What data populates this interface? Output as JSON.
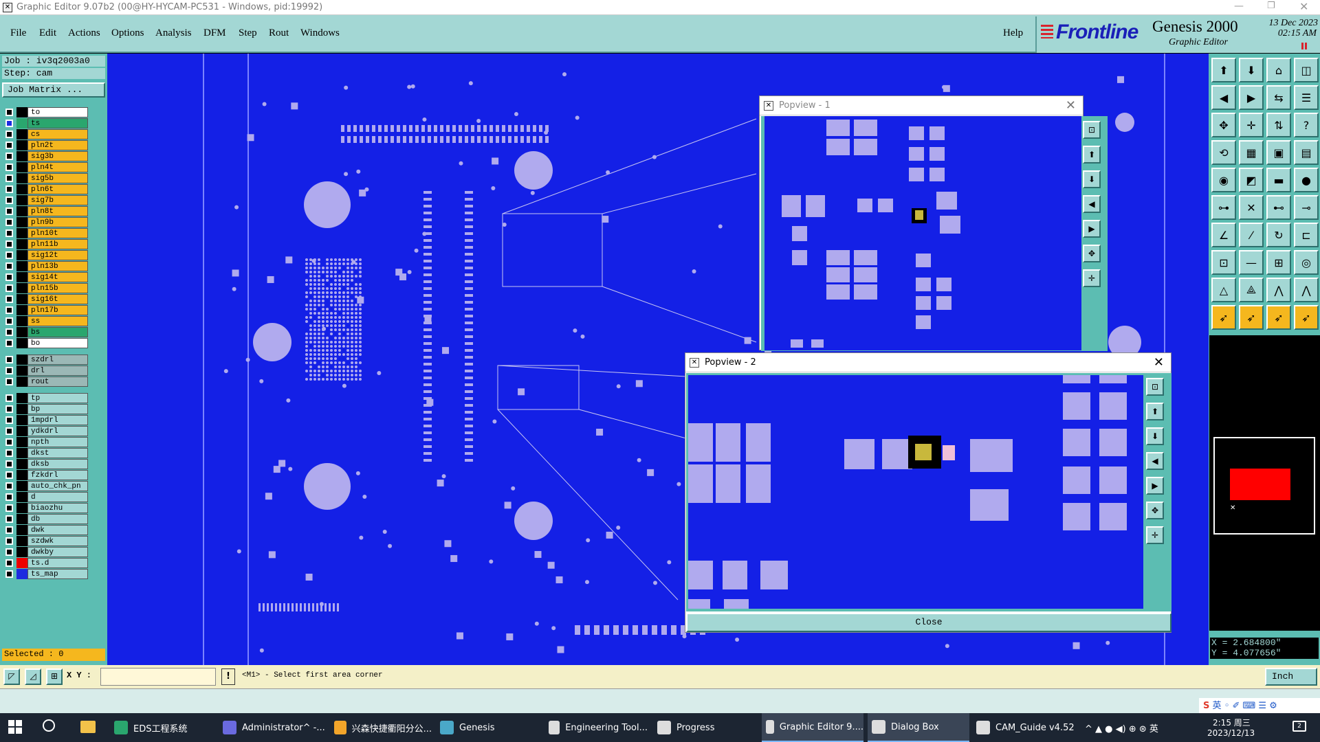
{
  "window": {
    "title": "Graphic Editor 9.07b2 (00@HY-HYCAM-PC531 - Windows, pid:19992)"
  },
  "menus": [
    "File",
    "Edit",
    "Actions",
    "Options",
    "Analysis",
    "DFM",
    "Step",
    "Rout",
    "Windows"
  ],
  "help": "Help",
  "brand": {
    "logo": "Frontline",
    "product": "Genesis 2000",
    "subtitle": "Graphic Editor",
    "date": "13 Dec 2023",
    "time": "02:15 AM"
  },
  "job": {
    "job_label": "Job  :  iv3q2003a0",
    "step_label": "Step:  cam",
    "matrix_button": "Job Matrix ..."
  },
  "layers": [
    {
      "name": "to",
      "color": "#ffffff"
    },
    {
      "name": "ts",
      "color": "#2aa66e"
    },
    {
      "name": "cs",
      "color": "#f5b71e"
    },
    {
      "name": "pln2t",
      "color": "#f5b71e"
    },
    {
      "name": "sig3b",
      "color": "#f5b71e"
    },
    {
      "name": "pln4t",
      "color": "#f5b71e"
    },
    {
      "name": "sig5b",
      "color": "#f5b71e"
    },
    {
      "name": "pln6t",
      "color": "#f5b71e"
    },
    {
      "name": "sig7b",
      "color": "#f5b71e"
    },
    {
      "name": "pln8t",
      "color": "#f5b71e"
    },
    {
      "name": "pln9b",
      "color": "#f5b71e"
    },
    {
      "name": "pln10t",
      "color": "#f5b71e"
    },
    {
      "name": "pln11b",
      "color": "#f5b71e"
    },
    {
      "name": "sig12t",
      "color": "#f5b71e"
    },
    {
      "name": "pln13b",
      "color": "#f5b71e"
    },
    {
      "name": "sig14t",
      "color": "#f5b71e"
    },
    {
      "name": "pln15b",
      "color": "#f5b71e"
    },
    {
      "name": "sig16t",
      "color": "#f5b71e"
    },
    {
      "name": "pln17b",
      "color": "#f5b71e"
    },
    {
      "name": "ss",
      "color": "#f5b71e"
    },
    {
      "name": "bs",
      "color": "#2aa66e"
    },
    {
      "name": "bo",
      "color": "#ffffff"
    },
    {
      "name": "szdrl",
      "color": "#9bb8b6"
    },
    {
      "name": "drl",
      "color": "#9bb8b6"
    },
    {
      "name": "rout",
      "color": "#9bb8b6"
    },
    {
      "name": "tp",
      "color": "#a3d7d4"
    },
    {
      "name": "bp",
      "color": "#a3d7d4"
    },
    {
      "name": "1mpdrl",
      "color": "#a3d7d4"
    },
    {
      "name": "ydkdrl",
      "color": "#a3d7d4"
    },
    {
      "name": "npth",
      "color": "#a3d7d4"
    },
    {
      "name": "dkst",
      "color": "#a3d7d4"
    },
    {
      "name": "dksb",
      "color": "#a3d7d4"
    },
    {
      "name": "fzkdrl",
      "color": "#a3d7d4"
    },
    {
      "name": "auto_chk_pn",
      "color": "#a3d7d4"
    },
    {
      "name": "d",
      "color": "#a3d7d4"
    },
    {
      "name": "biaozhu",
      "color": "#a3d7d4"
    },
    {
      "name": "db",
      "color": "#a3d7d4"
    },
    {
      "name": "dwk",
      "color": "#a3d7d4"
    },
    {
      "name": "szdwk",
      "color": "#a3d7d4"
    },
    {
      "name": "dwkby",
      "color": "#a3d7d4"
    },
    {
      "name": "ts.d",
      "color": "#a3d7d4"
    },
    {
      "name": "ts_map",
      "color": "#a3d7d4"
    }
  ],
  "selected": "Selected : 0",
  "popview1": {
    "title": "Popview - 1"
  },
  "popview2": {
    "title": "Popview - 2",
    "close_button": "Close"
  },
  "coords": {
    "x": "X = 2.684800\"",
    "y": "Y = 4.077656\""
  },
  "status": {
    "xy_label": "X Y :",
    "prompt": "<M1> - Select first area corner",
    "units": "Inch"
  },
  "taskbar": {
    "items": [
      "EDS工程系统",
      "Administrator^ -...",
      "兴森快捷衢阳分公...",
      "Genesis",
      "Engineering Tool...",
      "Progress",
      "Graphic Editor 9....",
      "Dialog Box",
      "CAM_Guide v4.52"
    ],
    "clock_time": "2:15 周三",
    "clock_date": "2023/12/13",
    "lang": "英"
  }
}
